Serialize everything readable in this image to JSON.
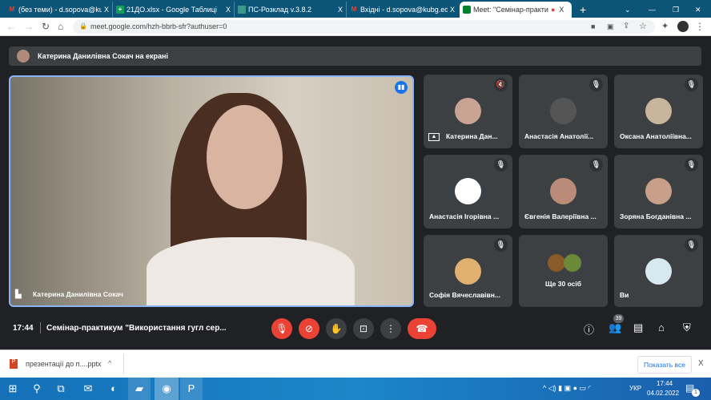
{
  "browser": {
    "tabs": [
      {
        "label": "(без теми) - d.sopova@kubg.",
        "icon": "gmail-icon"
      },
      {
        "label": "21ДО.xlsx - Google Таблиці",
        "icon": "sheets-icon"
      },
      {
        "label": "ПС-Розклад v.3.8.2",
        "icon": "schedule-icon"
      },
      {
        "label": "Вхідні - d.sopova@kubg.edu",
        "icon": "gmail-icon"
      },
      {
        "label": "Meet: \"Семінар-практи",
        "icon": "meet-icon",
        "active": true
      }
    ],
    "new_tab": "+",
    "close": "X",
    "url": "meet.google.com/hzh-bbrb-sfr?authuser=0"
  },
  "meet": {
    "presenting_banner": "Катерина Данилівна Сокач на екрані",
    "main_speaker": "Катерина Данилівна Сокач",
    "tiles": [
      {
        "name": "Катерина Дан...",
        "avatar": "#c9a393",
        "presenting": true
      },
      {
        "name": "Анастасія Анатолії...",
        "avatar": "#555"
      },
      {
        "name": "Оксана Анатоліївна...",
        "avatar": "#c9b49c"
      },
      {
        "name": "Анастасія Ігорівна ...",
        "avatar": "#ffffff"
      },
      {
        "name": "Євгенія Валеріївна ...",
        "avatar": "#b98b78"
      },
      {
        "name": "Зоряна Богданівна ...",
        "avatar": "#c8a08a"
      },
      {
        "name": "Софія Вячеславівн...",
        "avatar": "#e0b070"
      },
      {
        "name": "Ще 30 осіб",
        "avatar": "#8a5a2a",
        "more": true
      },
      {
        "name": "Ви",
        "avatar": "#d8e8f0"
      }
    ],
    "time": "17:44",
    "meeting_title": "Семінар-практикум \"Використання гугл сер...",
    "participants_count": "39",
    "accent": "#8ab4f8",
    "danger": "#ea4335"
  },
  "downloads": {
    "file": "презентації до п....pptx",
    "show_all": "Показать все",
    "close": "X"
  },
  "taskbar": {
    "lang": "УКР",
    "time": "17:44",
    "date": "04.02.2022",
    "notifications": "1"
  }
}
